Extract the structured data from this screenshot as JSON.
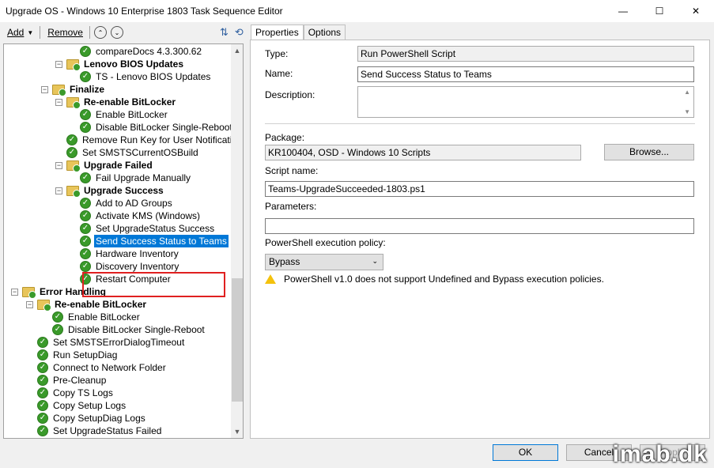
{
  "window": {
    "title": "Upgrade OS - Windows 10 Enterprise 1803 Task Sequence Editor",
    "minimize": "—",
    "maximize": "☐",
    "close": "✕"
  },
  "toolbar": {
    "add": "Add",
    "remove": "Remove",
    "up": "⌃",
    "down": "⌄"
  },
  "tree": [
    {
      "text": "compareDocs 4.3.300.62",
      "type": "step"
    },
    {
      "text": "Lenovo BIOS Updates",
      "type": "group"
    },
    {
      "text": "TS - Lenovo BIOS Updates",
      "type": "step"
    },
    {
      "text": "Finalize",
      "type": "group"
    },
    {
      "text": "Re-enable BitLocker",
      "type": "group"
    },
    {
      "text": "Enable BitLocker",
      "type": "step"
    },
    {
      "text": "Disable BitLocker Single-Reboot",
      "type": "step"
    },
    {
      "text": "Remove Run Key for User Notification",
      "type": "step"
    },
    {
      "text": "Set SMSTSCurrentOSBuild",
      "type": "step"
    },
    {
      "text": "Upgrade Failed",
      "type": "group"
    },
    {
      "text": "Fail Upgrade Manually",
      "type": "step"
    },
    {
      "text": "Upgrade Success",
      "type": "group"
    },
    {
      "text": "Add to AD Groups",
      "type": "step"
    },
    {
      "text": "Activate KMS (Windows)",
      "type": "step"
    },
    {
      "text": "Set UpgradeStatus Success",
      "type": "step"
    },
    {
      "text": "Send Success Status to Teams",
      "type": "step",
      "selected": true
    },
    {
      "text": "Hardware Inventory",
      "type": "step"
    },
    {
      "text": "Discovery Inventory",
      "type": "step"
    },
    {
      "text": "Restart Computer",
      "type": "step"
    },
    {
      "text": "Error Handling",
      "type": "group"
    },
    {
      "text": "Re-enable BitLocker",
      "type": "group"
    },
    {
      "text": "Enable BitLocker",
      "type": "step"
    },
    {
      "text": "Disable BitLocker Single-Reboot",
      "type": "step"
    },
    {
      "text": "Set SMSTSErrorDialogTimeout",
      "type": "step"
    },
    {
      "text": "Run SetupDiag",
      "type": "step"
    },
    {
      "text": "Connect to Network Folder",
      "type": "step"
    },
    {
      "text": "Pre-Cleanup",
      "type": "step"
    },
    {
      "text": "Copy TS Logs",
      "type": "step"
    },
    {
      "text": "Copy Setup Logs",
      "type": "step"
    },
    {
      "text": "Copy SetupDiag Logs",
      "type": "step"
    },
    {
      "text": "Set UpgradeStatus Failed",
      "type": "step"
    }
  ],
  "tabs": [
    "Properties",
    "Options"
  ],
  "props": {
    "type_label": "Type:",
    "type_value": "Run PowerShell Script",
    "name_label": "Name:",
    "name_value": "Send Success Status to Teams",
    "desc_label": "Description:",
    "package_label": "Package:",
    "package_value": "KR100404, OSD - Windows 10 Scripts",
    "browse": "Browse...",
    "script_label": "Script name:",
    "script_value": "Teams-UpgradeSucceeded-1803.ps1",
    "params_label": "Parameters:",
    "params_value": "",
    "policy_label": "PowerShell execution policy:",
    "policy_value": "Bypass",
    "warning": "PowerShell v1.0 does not support Undefined and Bypass execution policies."
  },
  "buttons": {
    "ok": "OK",
    "cancel": "Cancel",
    "apply": "Apply"
  },
  "watermark": "imab.dk",
  "colors": {
    "selection": "#0078d7",
    "highlight_box": "#e02020"
  }
}
